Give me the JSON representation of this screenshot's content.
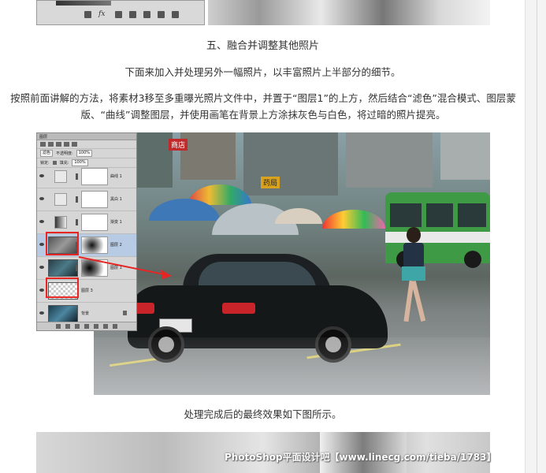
{
  "article": {
    "section_heading": "五、融合并调整其他照片",
    "paragraph_1": "下面来加入并处理另外一幅照片，以丰富照片上半部分的细节。",
    "paragraph_2": "按照前面讲解的方法，将素材3移至多重曝光照片文件中，并置于“图层1”的上方，然后结合“滤色”混合模式、图层蒙版、“曲线”调整图层，并使用画笔在背景上方涂抹灰色与白色，将过暗的照片提亮。",
    "caption": "处理完成后的最终效果如下图所示。"
  },
  "layers_panel": {
    "tab_label": "图层",
    "blend_mode": "滤色",
    "opacity_label": "不透明度:",
    "opacity_value": "100%",
    "lock_label": "锁定:",
    "fill_label": "填充:",
    "fill_value": "100%",
    "layers": [
      {
        "name": "曲线 1",
        "type": "adjustment"
      },
      {
        "name": "黑白 1",
        "type": "adjustment"
      },
      {
        "name": "渐变 1",
        "type": "adjustment"
      },
      {
        "name": "图层 2",
        "type": "photo",
        "selected": true
      },
      {
        "name": "图层 1",
        "type": "photo"
      },
      {
        "name": "图层 3",
        "type": "blank"
      },
      {
        "name": "背景",
        "type": "background"
      }
    ]
  },
  "street_signs": {
    "sign_1": "商店",
    "sign_2": "药局"
  },
  "watermark": "PhotoShop平面设计吧【www.linecg.com/tieba/1783】",
  "colors": {
    "highlight_red": "#e62525",
    "bus_green": "#3f9a45",
    "selected_layer": "#b8cbe4"
  }
}
